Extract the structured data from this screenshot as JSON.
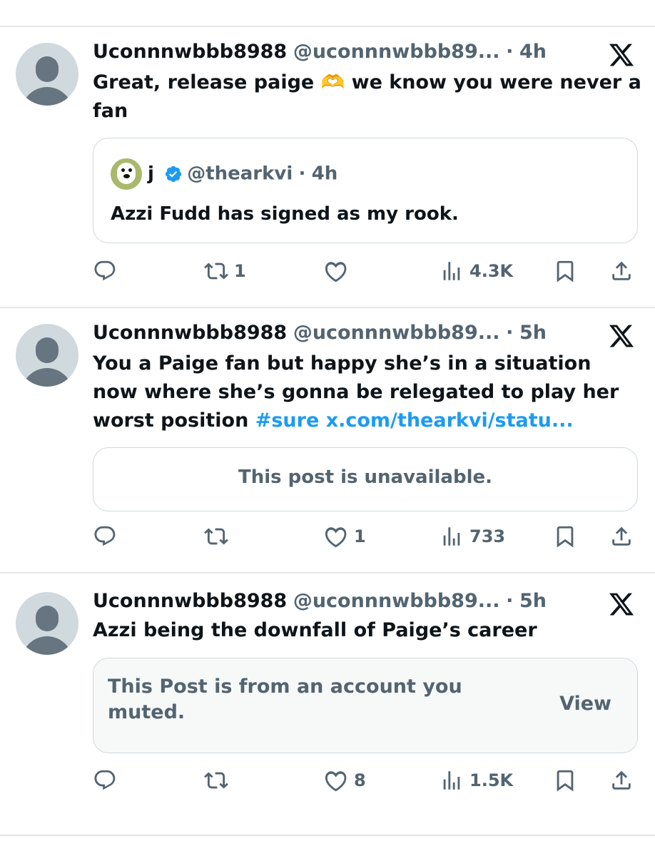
{
  "tweets": [
    {
      "name": "Uconnnwbbb8988",
      "handle": "@uconnnwbbb89...",
      "separator": "·",
      "time": "4h",
      "text_before": "Great, release paige ",
      "emoji": "🫶",
      "text_after": " we know you were never a fan",
      "quote": {
        "name": "j",
        "handle": "@thearkvi",
        "separator": "·",
        "time": "4h",
        "text": "Azzi Fudd has signed as my rook."
      },
      "replies": "",
      "reposts": "1",
      "likes": "",
      "views": "4.3K"
    },
    {
      "name": "Uconnnwbbb8988",
      "handle": "@uconnnwbbb89...",
      "separator": "·",
      "time": "5h",
      "text": "You a Paige fan but happy she’s in a situation now where she’s gonna be relegated to play her worst position ",
      "hashtag": "#sure",
      "url": "x.com/thearkvi/statu...",
      "card_text": "This post is unavailable.",
      "replies": "",
      "reposts": "",
      "likes": "1",
      "views": "733"
    },
    {
      "name": "Uconnnwbbb8988",
      "handle": "@uconnnwbbb89...",
      "separator": "·",
      "time": "5h",
      "text": "Azzi being the downfall of Paige’s career",
      "card_text": "This Post is from an account you muted.",
      "card_button": "View",
      "replies": "",
      "reposts": "",
      "likes": "8",
      "views": "1.5K"
    }
  ],
  "icons": {
    "reply": "reply-icon",
    "repost": "repost-icon",
    "like": "heart-icon",
    "views": "views-icon",
    "bookmark": "bookmark-icon",
    "share": "share-icon",
    "brand": "x-logo-icon"
  },
  "colors": {
    "text": "#0f1419",
    "secondary": "#536471",
    "link": "#1d9bf0",
    "border": "#cfd9de",
    "divider": "#e3e6e9",
    "muted_bg": "#f7f9f9"
  }
}
